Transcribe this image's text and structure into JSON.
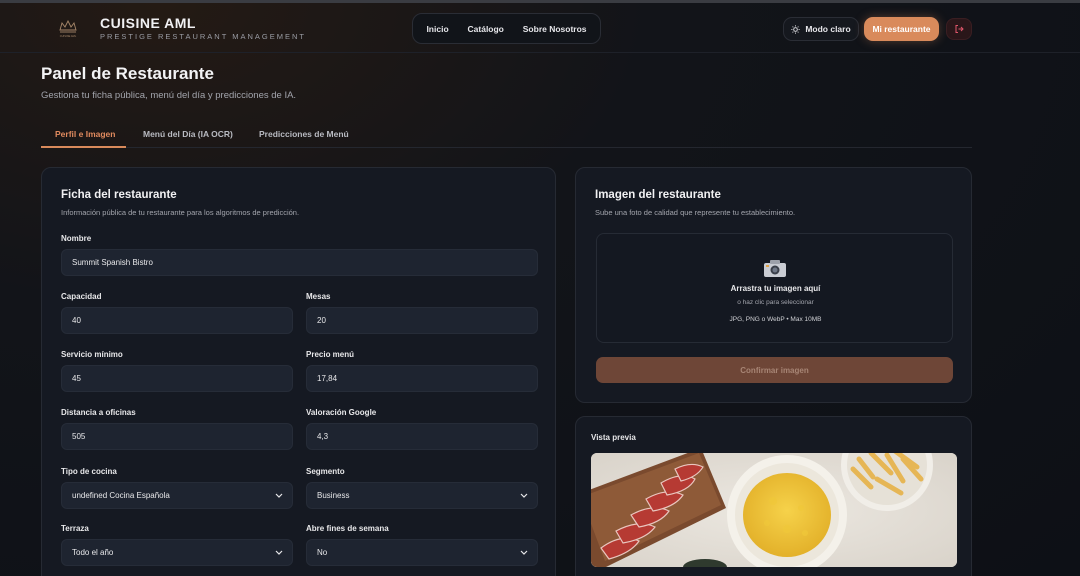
{
  "header": {
    "brand_title": "CUISINE AML",
    "brand_subtitle": "PRESTIGE RESTAURANT MANAGEMENT",
    "logo_text": "CUISINE AML",
    "nav": [
      "Inicio",
      "Catálogo",
      "Sobre Nosotros"
    ],
    "mode_label": "Modo claro",
    "my_restaurant_label": "Mi restaurante",
    "icons": {
      "mode": "sun-icon",
      "logout": "logout-icon"
    }
  },
  "page": {
    "title": "Panel de Restaurante",
    "subtitle": "Gestiona tu ficha pública, menú del día y predicciones de IA."
  },
  "tabs": [
    "Perfil e Imagen",
    "Menú del Día (IA OCR)",
    "Predicciones de Menú"
  ],
  "active_tab": "Perfil e Imagen",
  "profile": {
    "title": "Ficha del restaurante",
    "subtitle": "Información pública de tu restaurante para los algoritmos de predicción.",
    "fields": {
      "nombre": {
        "label": "Nombre",
        "value": "Summit Spanish Bistro"
      },
      "capacidad": {
        "label": "Capacidad",
        "value": "40"
      },
      "mesas": {
        "label": "Mesas",
        "value": "20"
      },
      "servicio_minimo": {
        "label": "Servicio mínimo",
        "value": "45"
      },
      "precio_menu": {
        "label": "Precio menú",
        "value": "17,84"
      },
      "distancia": {
        "label": "Distancia a oficinas",
        "value": "505"
      },
      "valoracion": {
        "label": "Valoración Google",
        "value": "4,3"
      },
      "tipo_cocina": {
        "label": "Tipo de cocina",
        "value": "undefined Cocina Española"
      },
      "segmento": {
        "label": "Segmento",
        "value": "Business"
      },
      "terraza": {
        "label": "Terraza",
        "value": "Todo el año"
      },
      "fines_semana": {
        "label": "Abre fines de semana",
        "value": "No"
      }
    }
  },
  "image_card": {
    "title": "Imagen del restaurante",
    "subtitle": "Sube una foto de calidad que represente tu establecimiento.",
    "drop_title": "Arrastra tu imagen aquí",
    "drop_sub": "o haz clic para seleccionar",
    "formats": "JPG, PNG o WebP • Max 10MB",
    "confirm_label": "Confirmar imagen"
  },
  "preview": {
    "label": "Vista previa"
  },
  "colors": {
    "accent": "#d98a5b",
    "background": "#121419",
    "card": "#151922",
    "input": "#1e2430"
  }
}
